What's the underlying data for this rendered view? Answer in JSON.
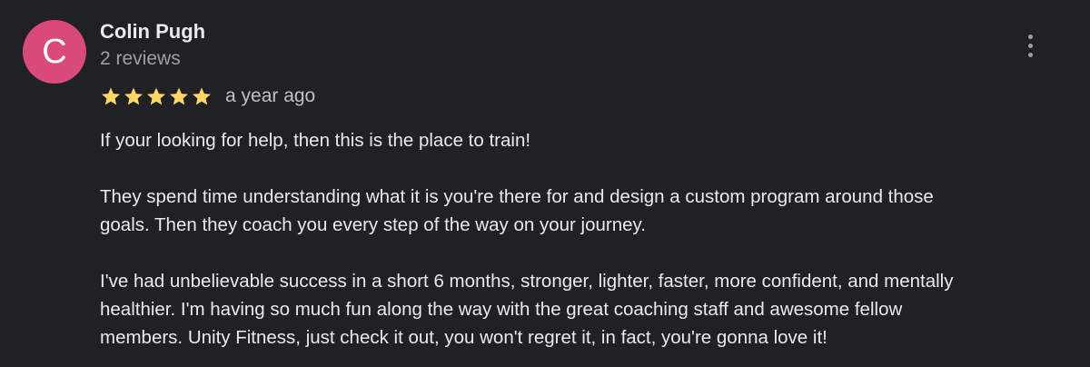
{
  "review": {
    "avatar_letter": "C",
    "author_name": "Colin Pugh",
    "author_meta": "2 reviews",
    "rating": 5,
    "rating_max": 5,
    "timestamp": "a year ago",
    "paragraphs": [
      "If your looking for help, then this is the place to train!",
      "They spend time understanding what it is you're there for and design a custom program around those\ngoals. Then they coach you every step of the way on your journey.",
      "I've had unbelievable success in a short 6 months, stronger, lighter, faster, more confident, and mentally\nhealthier. I'm having so much fun along the way with the great coaching staff and awesome fellow\nmembers. Unity Fitness, just check it out, you won't regret it, in fact, you're gonna love it!"
    ],
    "more_icon": "more-vertical-icon",
    "star_icon": "star-icon"
  },
  "colors": {
    "background": "#202124",
    "avatar": "#d9497a",
    "star": "#fdd663",
    "primary_text": "#e8eaed",
    "secondary_text": "#9aa0a6"
  }
}
